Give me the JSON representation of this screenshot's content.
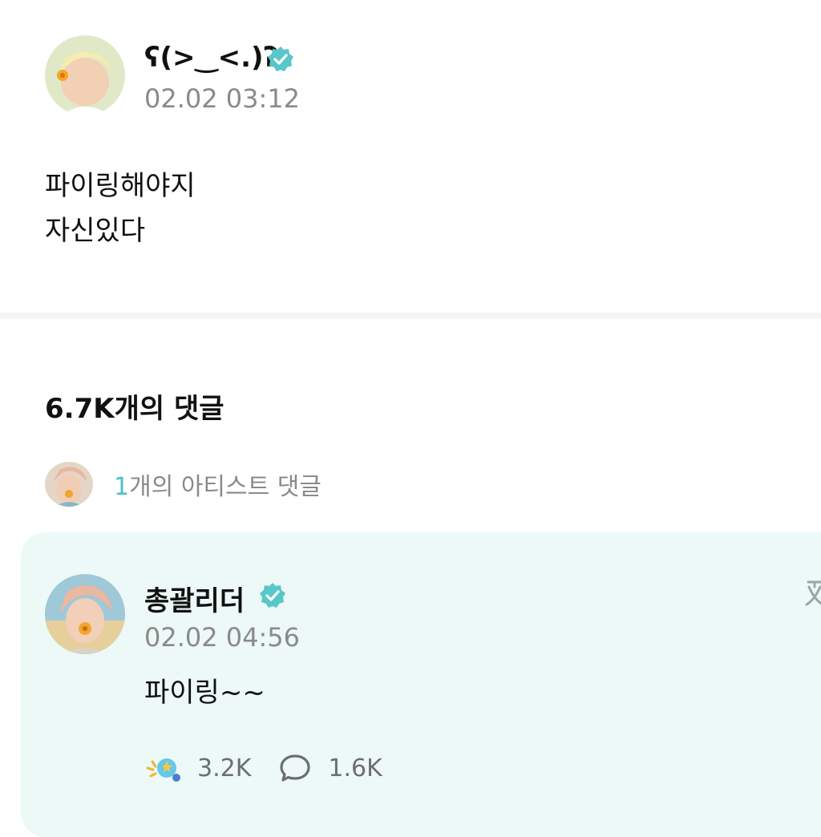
{
  "post": {
    "author": "ʕ(>‿<.)ʔ",
    "timestamp": "02.02 03:12",
    "lines": [
      "파이링해야지",
      "자신있다"
    ]
  },
  "comments": {
    "count_title": "6.7K개의 댓글",
    "artist_summary": {
      "count": "1",
      "suffix": "개의 아티스트 댓글"
    }
  },
  "artist_comment": {
    "author": "총괄리더",
    "timestamp": "02.02 04:56",
    "text": "파이링~~",
    "likes": "3.2K",
    "replies": "1.6K"
  },
  "colors": {
    "accent": "#4cc2c4",
    "card_bg": "#ecf9f7",
    "muted_text": "#8a8a8a"
  },
  "icons": [
    "verified-badge-icon",
    "like-cheer-icon",
    "reply-bubble-icon",
    "translate-icon"
  ]
}
